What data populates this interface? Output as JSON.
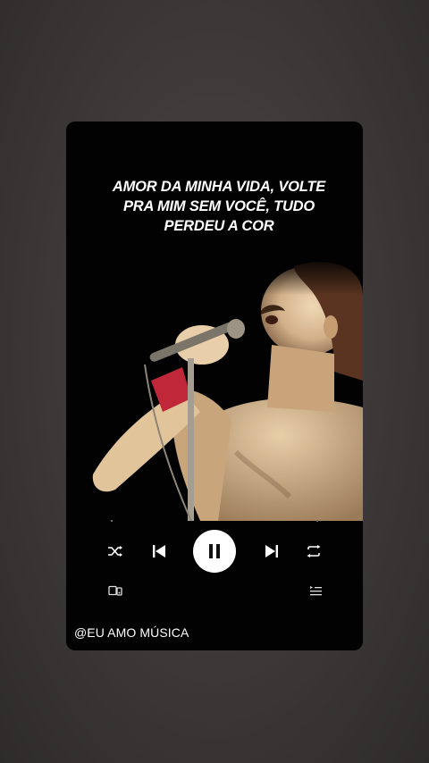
{
  "lyrics": {
    "line1": "AMOR DA MINHA VIDA, VOLTE",
    "line2": "PRA MIM SEM VOCÊ, TUDO",
    "line3": "PERDEU A COR"
  },
  "player": {
    "progress": 0.0,
    "state": "playing",
    "icons": {
      "shuffle": "shuffle-icon",
      "previous": "skip-previous-icon",
      "play_pause": "pause-icon",
      "next": "skip-next-icon",
      "repeat": "repeat-icon",
      "devices": "connect-device-icon",
      "queue": "queue-icon"
    }
  },
  "watermark": {
    "handle": "@EU AMO MÚSICA"
  },
  "colors": {
    "card_background": "#020202",
    "text": "#ffffff",
    "background": "#3c3838"
  }
}
